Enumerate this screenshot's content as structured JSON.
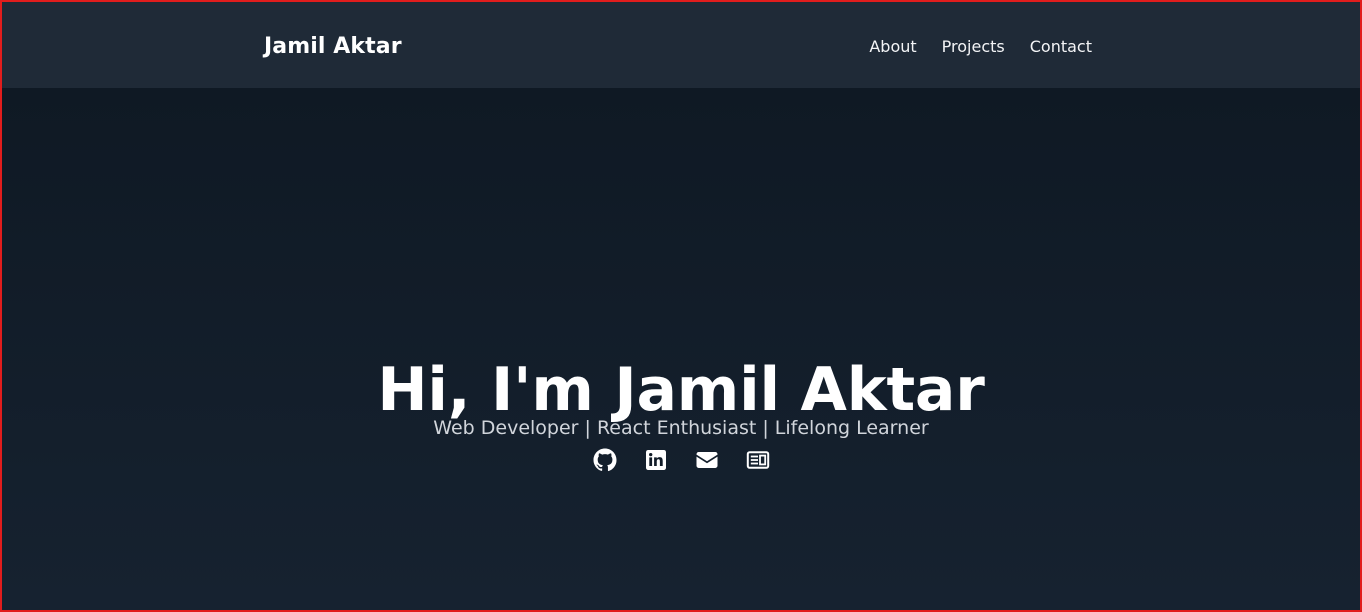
{
  "header": {
    "brand": "Jamil Aktar",
    "nav": [
      {
        "label": "About"
      },
      {
        "label": "Projects"
      },
      {
        "label": "Contact"
      }
    ]
  },
  "hero": {
    "title": "Hi, I'm Jamil Aktar",
    "subtitle": "Web Developer | React Enthusiast | Lifelong Learner",
    "socials": [
      {
        "icon": "github-icon"
      },
      {
        "icon": "linkedin-icon"
      },
      {
        "icon": "envelope-icon"
      },
      {
        "icon": "blog-icon"
      }
    ]
  },
  "colors": {
    "header_background": "#1f2a37",
    "page_background": "#111b27",
    "text_primary": "#ffffff",
    "text_secondary": "#d1d5db",
    "frame_border": "#e11d1d"
  }
}
